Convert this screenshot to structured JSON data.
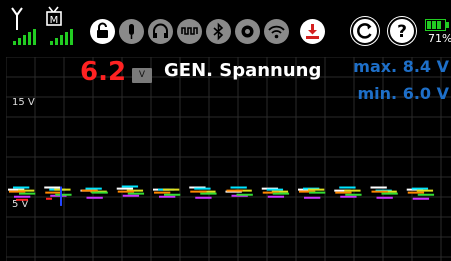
{
  "status": {
    "signal1": {
      "icon": "antenna-icon",
      "bars": 5
    },
    "signal2": {
      "icon": "tv-receiver-icon",
      "label": "M",
      "bars": 5
    },
    "icons": [
      "unlock-icon",
      "mic-icon",
      "headphones-icon",
      "waveform-icon",
      "bluetooth-icon",
      "settings-icon",
      "wifi-icon",
      "download-icon"
    ],
    "battery_pct": "71%"
  },
  "header": {
    "current_value": "6.2",
    "unit": "V",
    "title": "GEN. Spannung",
    "max_label": "max. 8.4 V",
    "min_label": "min. 6.0 V"
  },
  "colors": {
    "value_red": "#ff2222",
    "stats_blue": "#1e6fc8",
    "signal_green": "#22cc22",
    "battery_green": "#22cc22"
  },
  "chart_data": {
    "type": "line",
    "title": "GEN. Spannung",
    "ylabel": "V",
    "yticks": [
      "15 V",
      "5 V"
    ],
    "ytick_values": [
      15,
      5
    ],
    "ylim": [
      0,
      20
    ],
    "grid": true,
    "series": [
      {
        "color": "#ffffff",
        "values": [
          7.0,
          7.2,
          6.9,
          7.1,
          7.0,
          7.2,
          6.8,
          7.1,
          7.0,
          6.9,
          7.2,
          7.0
        ]
      },
      {
        "color": "#00e5ff",
        "values": [
          7.2,
          7.0,
          7.1,
          7.3,
          7.0,
          7.1,
          7.2,
          7.0,
          7.1,
          7.2,
          6.9,
          7.1
        ]
      },
      {
        "color": "#e0e020",
        "values": [
          6.9,
          7.0,
          6.8,
          6.9,
          7.0,
          6.8,
          6.9,
          6.8,
          7.0,
          6.9,
          6.8,
          6.9
        ]
      },
      {
        "color": "#ff8800",
        "values": [
          6.8,
          6.7,
          6.9,
          6.8,
          6.7,
          6.8,
          6.9,
          6.7,
          6.8,
          6.7,
          6.8,
          6.7
        ]
      },
      {
        "color": "#cc33ff",
        "values": [
          6.3,
          6.4,
          6.2,
          6.4,
          6.3,
          6.2,
          6.4,
          6.3,
          6.2,
          6.3,
          6.2,
          6.1
        ]
      },
      {
        "color": "#33dd33",
        "values": [
          6.6,
          6.5,
          6.7,
          6.6,
          6.5,
          6.6,
          6.5,
          6.6,
          6.7,
          6.5,
          6.6,
          6.5
        ]
      },
      {
        "color": "#ff2222",
        "values": [
          6.0,
          6.1
        ]
      },
      {
        "color": "#2244ff",
        "values": [
          7.3,
          5.4
        ]
      }
    ]
  }
}
